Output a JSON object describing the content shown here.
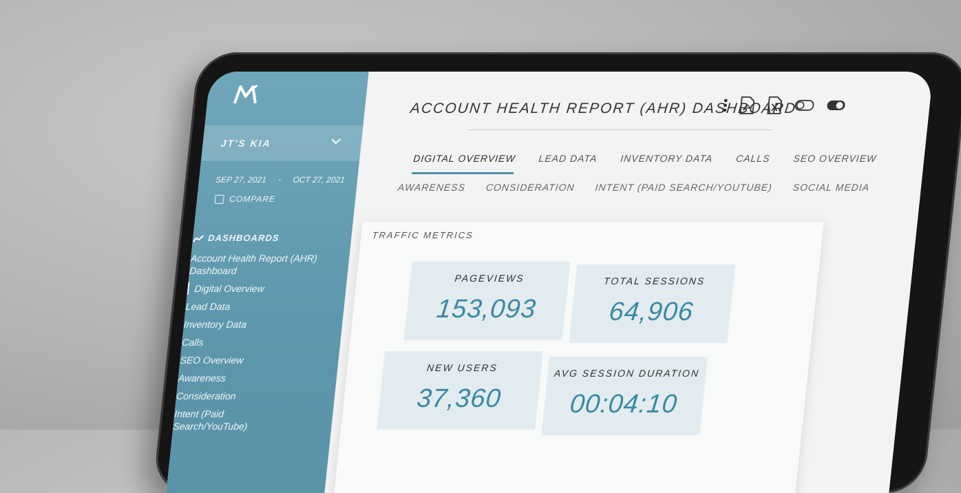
{
  "app": {
    "title": "ACCOUNT HEALTH REPORT (AHR) DASHBOARD"
  },
  "sidebar": {
    "account": "JT'S KIA",
    "date_start": "SEP 27, 2021",
    "date_sep": "-",
    "date_end": "OCT 27, 2021",
    "compare_label": "COMPARE",
    "dashboards_heading": "DASHBOARDS",
    "items": [
      {
        "label": "Account Health Report (AHR) Dashboard"
      },
      {
        "label": "Digital Overview"
      },
      {
        "label": "Lead Data"
      },
      {
        "label": "Inventory Data"
      },
      {
        "label": "Calls"
      },
      {
        "label": "SEO Overview"
      },
      {
        "label": "Awareness"
      },
      {
        "label": "Consideration"
      },
      {
        "label": "Intent (Paid Search/YouTube)"
      }
    ]
  },
  "tabs_primary": [
    {
      "label": "DIGITAL OVERVIEW"
    },
    {
      "label": "LEAD DATA"
    },
    {
      "label": "INVENTORY DATA"
    },
    {
      "label": "CALLS"
    },
    {
      "label": "SEO OVERVIEW"
    }
  ],
  "tabs_secondary": [
    {
      "label": "AWARENESS"
    },
    {
      "label": "CONSIDERATION"
    },
    {
      "label": "INTENT (PAID SEARCH/YOUTUBE)"
    },
    {
      "label": "SOCIAL MEDIA"
    }
  ],
  "traffic": {
    "title": "TRAFFIC METRICS",
    "metrics": [
      {
        "label": "PAGEVIEWS",
        "value": "153,093"
      },
      {
        "label": "TOTAL SESSIONS",
        "value": "64,906"
      },
      {
        "label": "NEW USERS",
        "value": "37,360"
      },
      {
        "label": "AVG SESSION DURATION",
        "value": "00:04:10"
      }
    ]
  },
  "colors": {
    "sidebar": "#5e97ad",
    "accent": "#3b88a4",
    "metric_bg": "#e2ecf0"
  }
}
